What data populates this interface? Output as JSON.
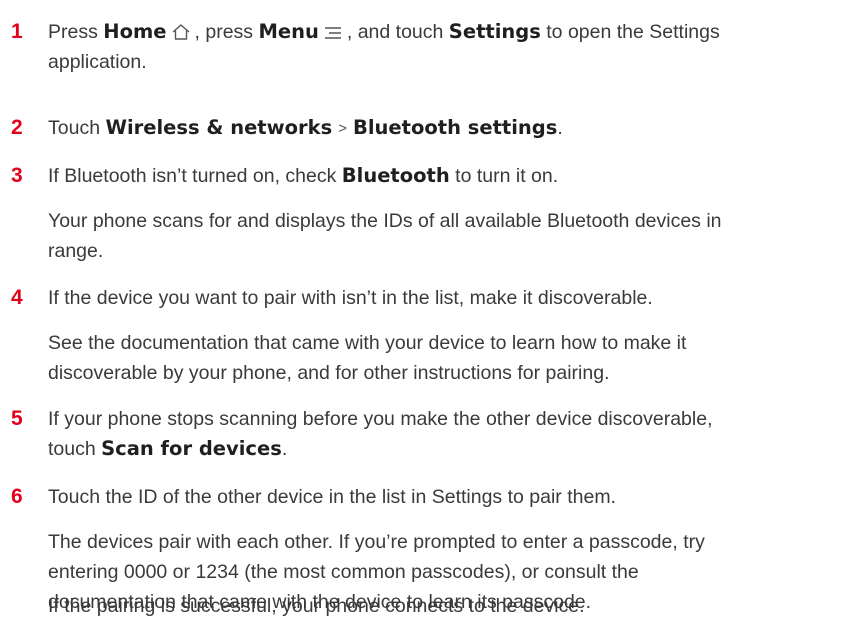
{
  "steps": [
    {
      "number": "1",
      "line1_a": "Press ",
      "home_label": "Home",
      "line1_b": ", press ",
      "menu_label": "Menu",
      "line1_c": ", and touch ",
      "settings_label": "Settings",
      "line1_d": " to open the Settings",
      "line2": "application.",
      "icons": [
        "home-icon",
        "menu-icon"
      ]
    },
    {
      "number": "2",
      "text_a": "Touch ",
      "wireless_label": "Wireless & networks",
      "separator": ">",
      "bt_settings_label": "Bluetooth settings",
      "text_b": "."
    },
    {
      "number": "3",
      "text_a": "If Bluetooth isn’t turned on, check ",
      "bluetooth_label": "Bluetooth",
      "text_b": " to turn it on.",
      "note_line1": "Your phone scans for and displays the IDs of all available Bluetooth devices in",
      "note_line2": "range."
    },
    {
      "number": "4",
      "text": "If the device you want to pair with isn’t in the list, make it discoverable.",
      "note_line1": "See the documentation that came with your device to learn how to make it",
      "note_line2": "discoverable by your phone, and for other instructions for pairing."
    },
    {
      "number": "5",
      "line1": "If your phone stops scanning before you make the other device discoverable,",
      "line2_a": "touch ",
      "scan_label": "Scan for devices",
      "line2_b": "."
    },
    {
      "number": "6",
      "text": "Touch the ID of the other device in the list in Settings to pair them.",
      "note1_line1": "The devices pair with each other. If you’re prompted to enter a passcode, try",
      "note1_line2": "entering 0000 or 1234 (the most common passcodes), or consult the",
      "note1_line3": "documentation that came with the device to learn its passcode.",
      "note2": "If the pairing is successful, your phone connects to the device."
    }
  ],
  "colors": {
    "step_number": "#e3001b",
    "body_text": "#3a3a3a",
    "bold_text": "#1f1f1f"
  }
}
